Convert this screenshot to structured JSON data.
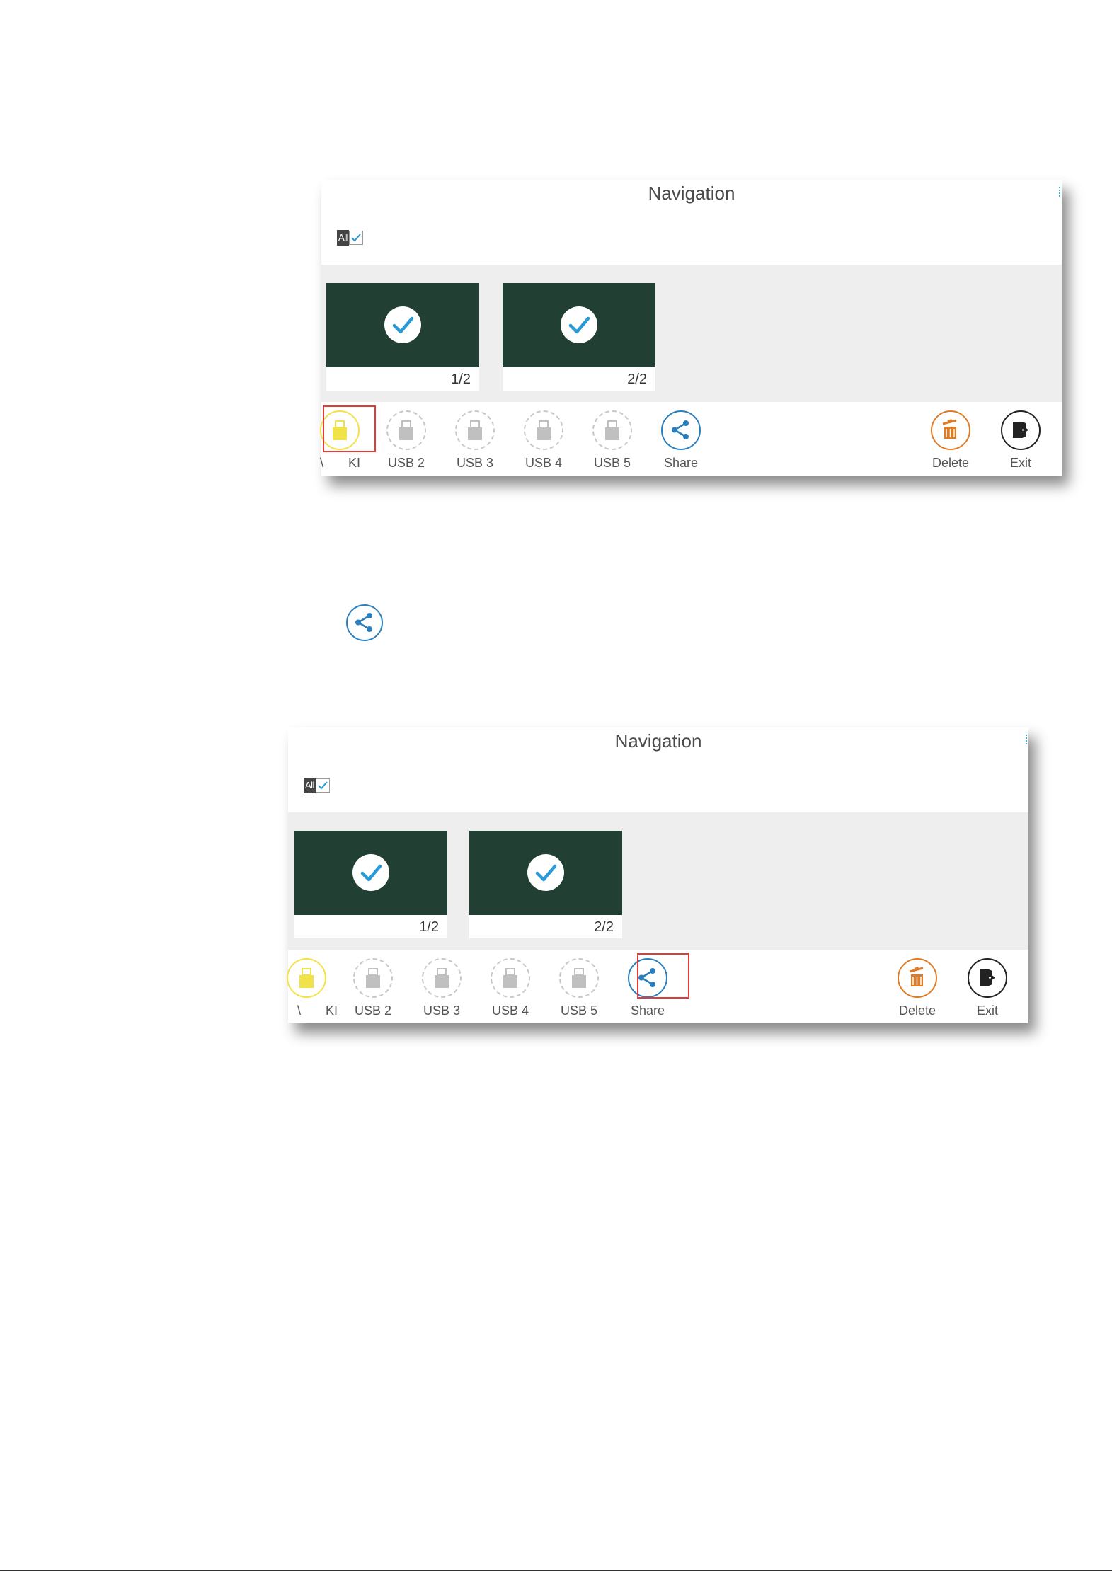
{
  "panels": [
    {
      "title": "Navigation",
      "select_all_label": "All",
      "pages": [
        {
          "number": "1/2",
          "selected": true
        },
        {
          "number": "2/2",
          "selected": true
        }
      ],
      "usb_partial_label_left": "\\",
      "usb_partial_label_right": "KI",
      "tools": {
        "usb2": "USB 2",
        "usb3": "USB 3",
        "usb4": "USB 4",
        "usb5": "USB 5",
        "share": "Share",
        "delete": "Delete",
        "exit": "Exit"
      },
      "highlighted_tool": "usb1"
    },
    {
      "title": "Navigation",
      "select_all_label": "All",
      "pages": [
        {
          "number": "1/2",
          "selected": true
        },
        {
          "number": "2/2",
          "selected": true
        }
      ],
      "usb_partial_label_left": "\\",
      "usb_partial_label_right": "KI",
      "tools": {
        "usb2": "USB 2",
        "usb3": "USB 3",
        "usb4": "USB 4",
        "usb5": "USB 5",
        "share": "Share",
        "delete": "Delete",
        "exit": "Exit"
      },
      "highlighted_tool": "share"
    }
  ],
  "standalone_icon": "share-icon",
  "colors": {
    "thumbnail": "#223f33",
    "check": "#2a9ad6",
    "usb_active": "#f2e24a",
    "usb_disabled": "#c8c8c8",
    "share": "#2a7fbf",
    "delete": "#e07b25",
    "highlight_box": "#e33a3a"
  }
}
